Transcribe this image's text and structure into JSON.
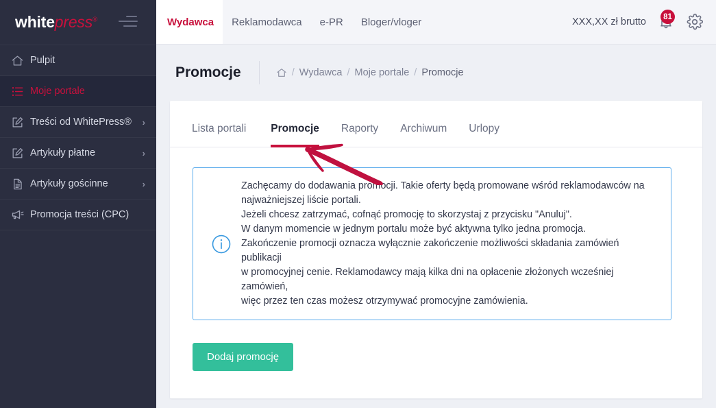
{
  "sidebar": {
    "logo": {
      "part1": "white",
      "part2": "press",
      "trademark": "®"
    },
    "menu_icon": "hamburger-icon",
    "items": [
      {
        "label": "Pulpit",
        "icon": "home-icon",
        "active": false,
        "chevron": ""
      },
      {
        "label": "Moje portale",
        "icon": "list-icon",
        "active": true,
        "chevron": ""
      },
      {
        "label": "Treści od WhitePress®",
        "icon": "edit-square-icon",
        "active": false,
        "chevron": "›"
      },
      {
        "label": "Artykuły płatne",
        "icon": "edit-square-icon",
        "active": false,
        "chevron": "›"
      },
      {
        "label": "Artykuły gościnne",
        "icon": "document-icon",
        "active": false,
        "chevron": "›"
      },
      {
        "label": "Promocja treści (CPC)",
        "icon": "megaphone-icon",
        "active": false,
        "chevron": ""
      }
    ]
  },
  "topbar": {
    "nav": [
      {
        "label": "Wydawca",
        "active": true
      },
      {
        "label": "Reklamodawca",
        "active": false
      },
      {
        "label": "e-PR",
        "active": false
      },
      {
        "label": "Bloger/vloger",
        "active": false
      }
    ],
    "balance": "XXX,XX zł brutto",
    "notifications": {
      "icon": "bell-icon",
      "count": "81"
    },
    "settings": {
      "icon": "gear-icon"
    }
  },
  "page": {
    "title": "Promocje",
    "breadcrumb": {
      "home_icon": "home-icon",
      "items": [
        "Wydawca",
        "Moje portale",
        "Promocje"
      ],
      "separator": "/"
    }
  },
  "tabs": [
    {
      "label": "Lista portali",
      "active": false
    },
    {
      "label": "Promocje",
      "active": true
    },
    {
      "label": "Raporty",
      "active": false
    },
    {
      "label": "Archiwum",
      "active": false
    },
    {
      "label": "Urlopy",
      "active": false
    }
  ],
  "infobox": {
    "icon": "info-circle-icon",
    "lines": [
      "Zachęcamy do dodawania promocji. Takie oferty będą promowane wśród reklamodawców na",
      "najważniejszej liście portali.",
      "Jeżeli chcesz zatrzymać, cofnąć promocję to skorzystaj z przycisku \"Anuluj\".",
      "W danym momencie w jednym portalu może być aktywna tylko jedna promocja.",
      "Zakończenie promocji oznacza wyłącznie zakończenie możliwości składania zamówień publikacji",
      "w promocyjnej cenie. Reklamodawcy mają kilka dni na opłacenie złożonych wcześniej zamówień,",
      "więc przez ten czas możesz otrzymywać promocyjne zamówienia."
    ]
  },
  "actions": {
    "add_promotion": "Dodaj promocję"
  },
  "annotation": {
    "arrow": "red-arrow-pointing-to-promocje-tab"
  },
  "colors": {
    "sidebar_bg": "#2b2e40",
    "sidebar_active_bg": "#24273a",
    "brand_red": "#c8103c",
    "page_bg": "#eef0f5",
    "topbar_bg": "#f4f5f9",
    "info_border": "#5bacec",
    "info_icon": "#3a9ae0",
    "button_green": "#33bf9b",
    "text_dark": "#232736",
    "text_muted": "#7d8194"
  }
}
